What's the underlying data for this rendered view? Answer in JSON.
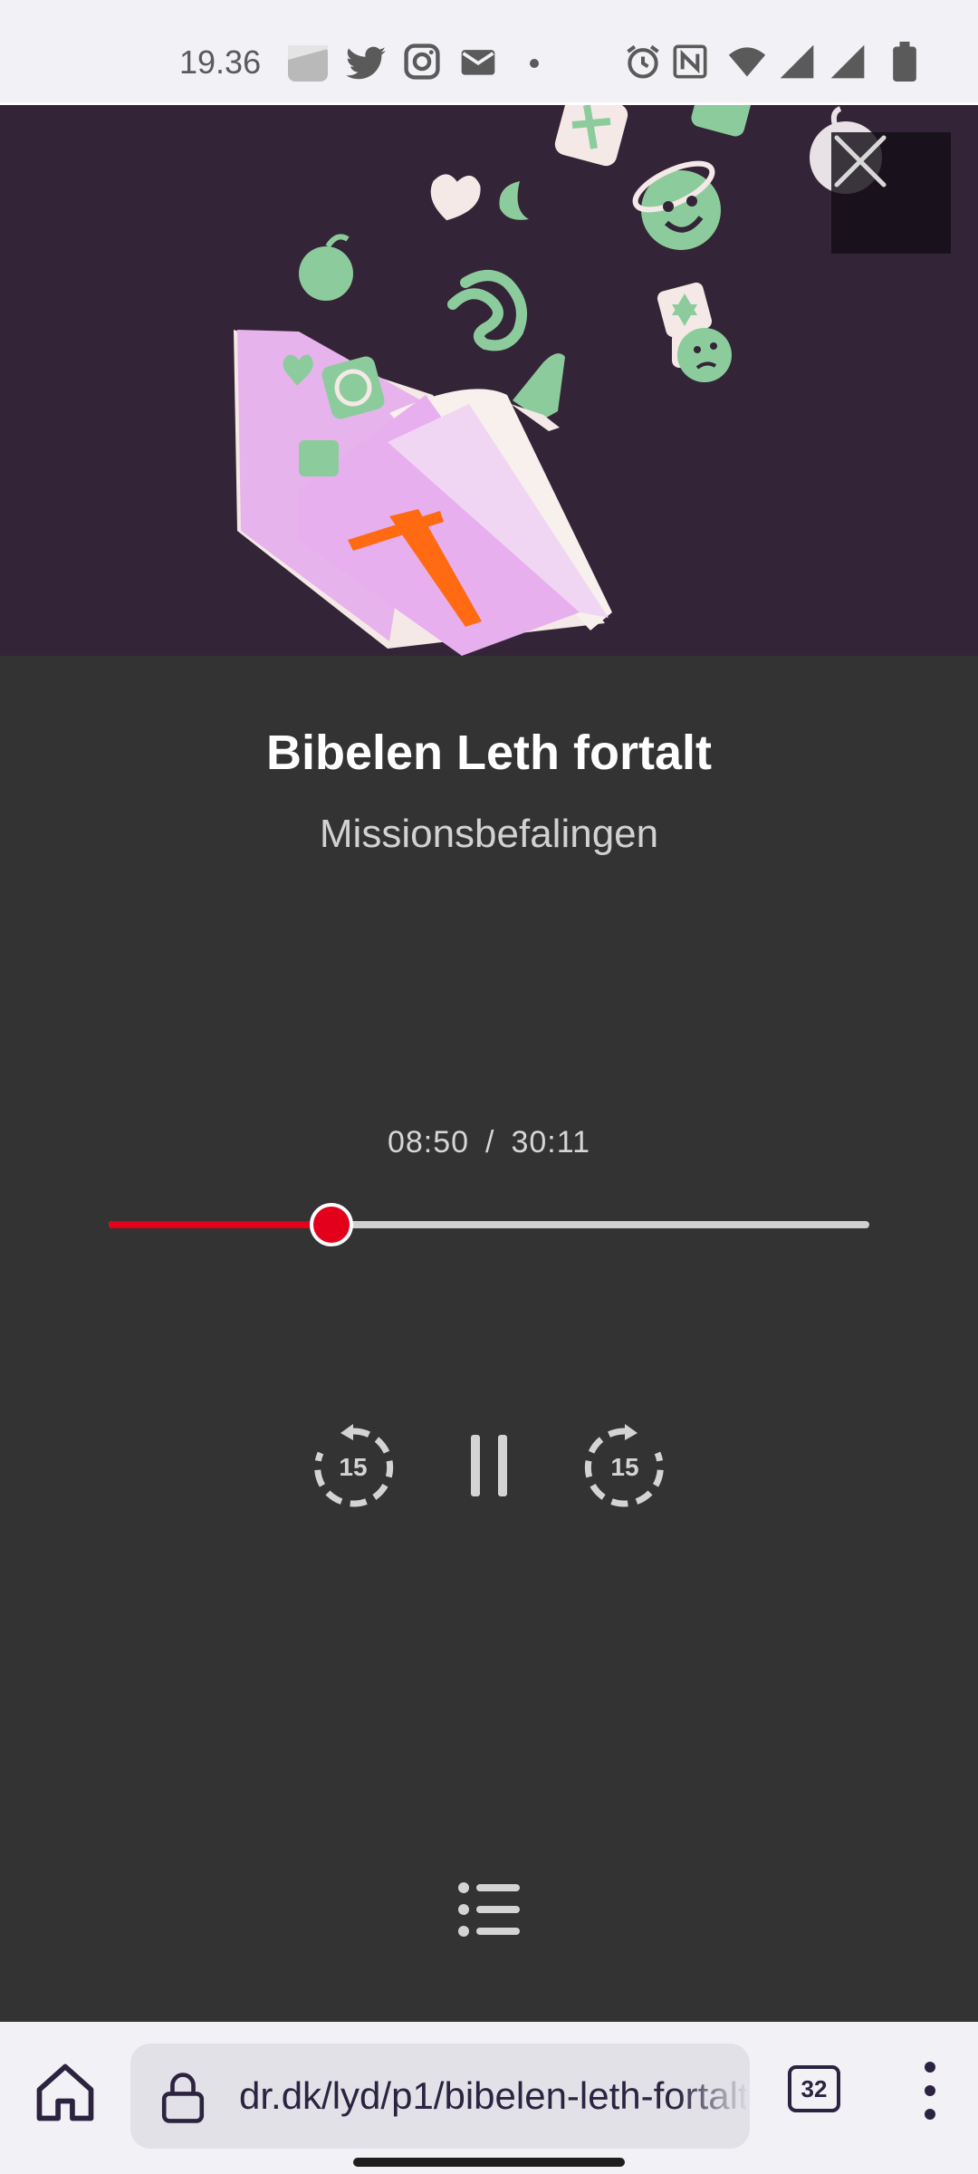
{
  "status_bar": {
    "time": "19.36",
    "left_icons": [
      "gallery-icon",
      "twitter-icon",
      "instagram-icon",
      "mail-icon",
      "dot-icon"
    ],
    "right_icons": [
      "alarm-icon",
      "nfc-icon",
      "wifi-icon",
      "signal-icon",
      "signal-icon",
      "battery-icon"
    ]
  },
  "artwork": {
    "colors": {
      "background": "#342437",
      "book": "#eab0ee",
      "cross": "#ff6a12",
      "icons": "#8ccc9c"
    }
  },
  "player": {
    "title": "Bibelen Leth fortalt",
    "subtitle": "Missionsbefalingen",
    "elapsed": "08:50",
    "separator": "/",
    "duration": "30:11",
    "progress_fraction": 0.293,
    "accent_color": "#e3001b",
    "rewind_label": "15",
    "forward_label": "15"
  },
  "browser": {
    "url": "dr.dk/lyd/p1/bibelen-leth-fortalt",
    "tab_count": "32"
  }
}
